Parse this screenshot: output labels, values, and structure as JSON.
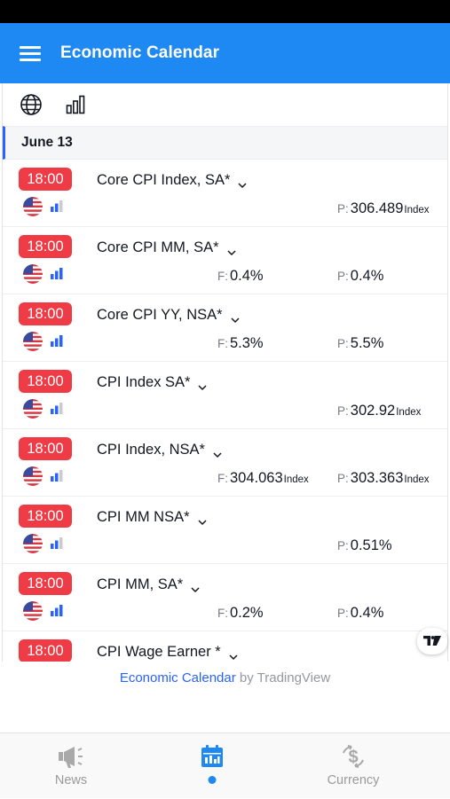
{
  "header": {
    "title": "Economic Calendar"
  },
  "date_header": "June 13",
  "colors": {
    "accent": "#1e88f3",
    "time_badge": "#ef3b45",
    "importance_high": "#2962ff",
    "importance_low": "#c8cbd3"
  },
  "events": [
    {
      "time": "18:00",
      "title": "Core CPI Index, SA*",
      "importance": "low",
      "forecast": null,
      "previous": {
        "label": "P:",
        "value": "306.489",
        "unit": "Index"
      }
    },
    {
      "time": "18:00",
      "title": "Core CPI MM, SA*",
      "importance": "high",
      "forecast": {
        "label": "F:",
        "value": "0.4%",
        "unit": ""
      },
      "previous": {
        "label": "P:",
        "value": "0.4%",
        "unit": ""
      }
    },
    {
      "time": "18:00",
      "title": "Core CPI YY, NSA*",
      "importance": "high",
      "forecast": {
        "label": "F:",
        "value": "5.3%",
        "unit": ""
      },
      "previous": {
        "label": "P:",
        "value": "5.5%",
        "unit": ""
      }
    },
    {
      "time": "18:00",
      "title": "CPI Index SA*",
      "importance": "low",
      "forecast": null,
      "previous": {
        "label": "P:",
        "value": "302.92",
        "unit": "Index"
      }
    },
    {
      "time": "18:00",
      "title": "CPI Index, NSA*",
      "importance": "low",
      "forecast": {
        "label": "F:",
        "value": "304.063",
        "unit": "Index"
      },
      "previous": {
        "label": "P:",
        "value": "303.363",
        "unit": "Index"
      }
    },
    {
      "time": "18:00",
      "title": "CPI MM NSA*",
      "importance": "low",
      "forecast": null,
      "previous": {
        "label": "P:",
        "value": "0.51%",
        "unit": ""
      }
    },
    {
      "time": "18:00",
      "title": "CPI MM, SA*",
      "importance": "high",
      "forecast": {
        "label": "F:",
        "value": "0.2%",
        "unit": ""
      },
      "previous": {
        "label": "P:",
        "value": "0.4%",
        "unit": ""
      }
    },
    {
      "time": "18:00",
      "title": "CPI Wage Earner *",
      "importance": "low",
      "forecast": null,
      "previous": null
    }
  ],
  "footer": {
    "link_text": "Economic Calendar",
    "by_text": " by TradingView"
  },
  "tv_logo_text": "TV",
  "bottom_nav": {
    "items": [
      {
        "label": "News",
        "icon": "megaphone-icon"
      },
      {
        "label": "",
        "icon": "calendar-icon",
        "active": true
      },
      {
        "label": "Currency",
        "icon": "currency-exchange-icon"
      }
    ]
  }
}
